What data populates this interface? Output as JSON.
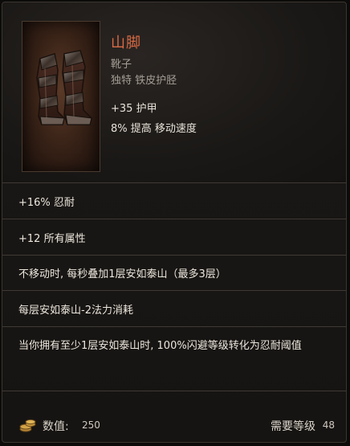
{
  "item": {
    "name": "山脚",
    "type": "靴子",
    "subtitle": "独特 铁皮护胫",
    "stats": {
      "armor": "+35 护甲",
      "speed": "8% 提高 移动速度"
    }
  },
  "affixes": [
    "+16% 忍耐",
    "+12 所有属性",
    "不移动时, 每秒叠加1层安如泰山（最多3层）",
    "每层安如泰山-2法力消耗",
    "当你拥有至少1层安如泰山时, 100%闪避等级转化为忍耐阈值"
  ],
  "footer": {
    "value_label": "数值:",
    "value": "250",
    "requirement_label": "需要等级",
    "requirement_level": "48"
  },
  "icons": {
    "item_art": "boots-icon",
    "currency": "coin-stack-icon"
  },
  "colors": {
    "unique_name": "#d96a45",
    "border": "#3e3934"
  }
}
